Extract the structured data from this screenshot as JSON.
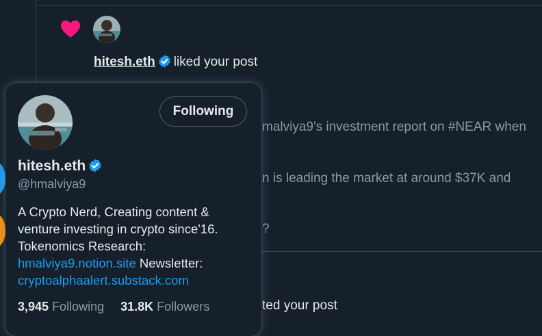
{
  "notification": {
    "user_name": "hitesh.eth",
    "action_text": "liked your post"
  },
  "post_fragments": {
    "line1": "malviya9's investment report on #NEAR when",
    "line2": "n is leading the market at around $37K and",
    "line3": "?"
  },
  "notification2": {
    "text": "ted your post"
  },
  "hover_card": {
    "follow_button_label": "Following",
    "name": "hitesh.eth",
    "handle": "@hmalviya9",
    "bio_line1": "A Crypto Nerd, Creating content &",
    "bio_line2": "venture investing in crypto since'16.",
    "bio_line3": "Tokenomics Research:",
    "bio_link1": "hmalviya9.notion.site",
    "bio_newsletter": "Newsletter:",
    "bio_link2": "cryptoalphaalert.substack.com",
    "following_count": "3,945",
    "following_label": "Following",
    "followers_count": "31.8K",
    "followers_label": "Followers"
  },
  "icons": {
    "like": "heart-icon",
    "verified": "verified-badge-icon"
  },
  "colors": {
    "background": "#15202b",
    "accent": "#1d9bf0",
    "heart": "#f91880",
    "muted_text": "#8b98a5"
  }
}
